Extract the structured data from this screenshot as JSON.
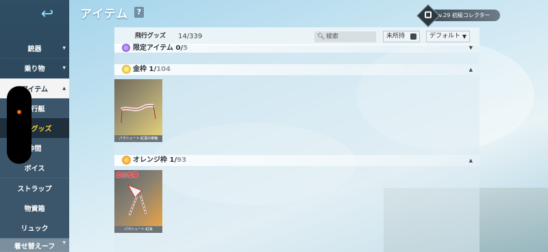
{
  "header": {
    "title": "アイテム",
    "help": "?",
    "level_badge": "Lv.29 初級コレクター"
  },
  "sidebar": {
    "back_icon": "back-arrow-icon",
    "items": [
      {
        "label": "銃器",
        "type": "category",
        "chevron": "▼"
      },
      {
        "label": "乗り物",
        "type": "category",
        "chevron": "▼"
      },
      {
        "label": "アイテム",
        "type": "category-open",
        "chevron": "▲"
      },
      {
        "label": "飛行艇",
        "type": "sub"
      },
      {
        "label": "飛行グッズ",
        "type": "sub-active"
      },
      {
        "label": "仲間",
        "type": "sub"
      },
      {
        "label": "ボイス",
        "type": "sub"
      },
      {
        "label": "ストラップ",
        "type": "sub"
      },
      {
        "label": "物資箱",
        "type": "sub"
      },
      {
        "label": "リュック",
        "type": "sub"
      },
      {
        "label": "着せ替えーフ",
        "type": "category",
        "chevron": "▼"
      }
    ]
  },
  "toolbar": {
    "label": "飛行グッズ",
    "count": "14/339",
    "search_placeholder": "検索",
    "filter_label": "未所持",
    "sort_label": "デフォルト",
    "sort_arrow": "▼"
  },
  "sections": [
    {
      "name": "限定アイテム",
      "owned": "0/",
      "total": "5",
      "gem": "purple",
      "chevron": "▼"
    },
    {
      "name": "金枠",
      "owned": "1/",
      "total": "104",
      "gem": "gold",
      "chevron": "▲"
    },
    {
      "name": "オレンジ枠",
      "owned": "1/",
      "total": "93",
      "gem": "orange",
      "chevron": "▲"
    }
  ],
  "cards": [
    {
      "caption": "パラシュート:紅蓮の御輪",
      "label": ""
    },
    {
      "caption": "パラシュート:紅来",
      "label": "東京喰種"
    }
  ],
  "colors": {
    "accent_yellow": "#ffd23a",
    "sidebar_bg": "#2f4d63",
    "gold_frame": "#e0a81c",
    "orange_frame": "#ee8a1c"
  }
}
